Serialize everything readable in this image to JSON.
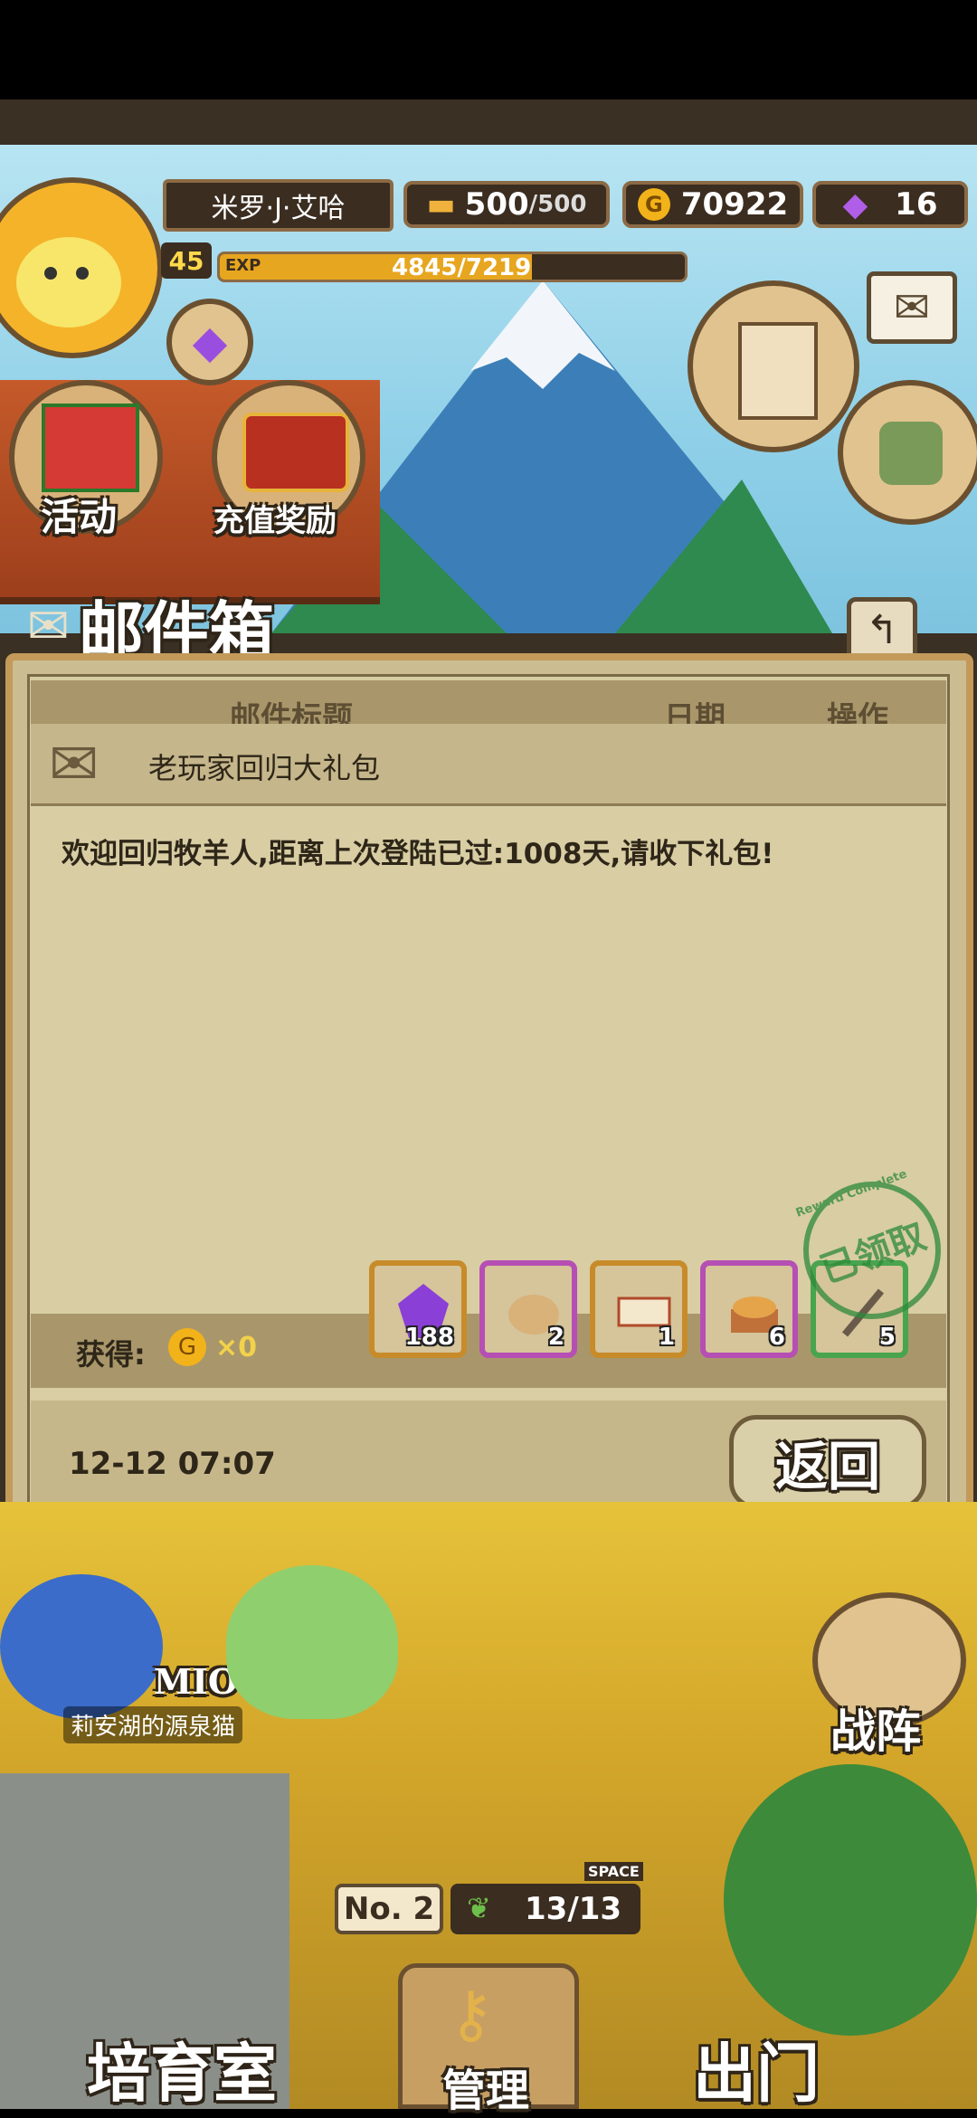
{
  "hud": {
    "player_name": "米罗·J·艾哈",
    "level": "45",
    "exp_label": "EXP",
    "exp_text": "4845/7219",
    "exp_fraction": 0.671,
    "stamina": "500",
    "stamina_max": "/500",
    "gold": "70922",
    "gems": "16"
  },
  "left_buttons": {
    "activity": "活动",
    "recharge": "充值奖励"
  },
  "mailbox": {
    "title": "邮件箱",
    "columns": [
      "邮件标题",
      "日期",
      "操作"
    ],
    "mail_subject": "老玩家回归大礼包",
    "message": "欢迎回归牧羊人,距离上次登陆已过:1008天,请收下礼包!",
    "obtain_label": "获得:",
    "gold_amount": "×0",
    "items": [
      {
        "icon": "gem-icon",
        "count": "188",
        "border": "#c88b2a"
      },
      {
        "icon": "food-bundle-icon",
        "count": "2",
        "border": "#b64fb4"
      },
      {
        "icon": "ticket-icon",
        "count": "1",
        "border": "#c88b2a"
      },
      {
        "icon": "bread-basket-icon",
        "count": "6",
        "border": "#b64fb4"
      },
      {
        "icon": "tool-icon",
        "count": "5",
        "border": "#49a44e"
      }
    ],
    "stamp_text": "已领取",
    "stamp_ring": "Reward Complete",
    "date": "12-12 07:07",
    "back_label": "返回"
  },
  "scene": {
    "pet_name": "MIO",
    "pet_title": "莉安湖的源泉猫",
    "formation_label": "战阵",
    "pasture_no": "No. 2",
    "space_label": "SPACE",
    "space_value": "13/13"
  },
  "bottom_nav": {
    "nursery": "培育室",
    "manage": "管理",
    "go_out": "出门"
  }
}
